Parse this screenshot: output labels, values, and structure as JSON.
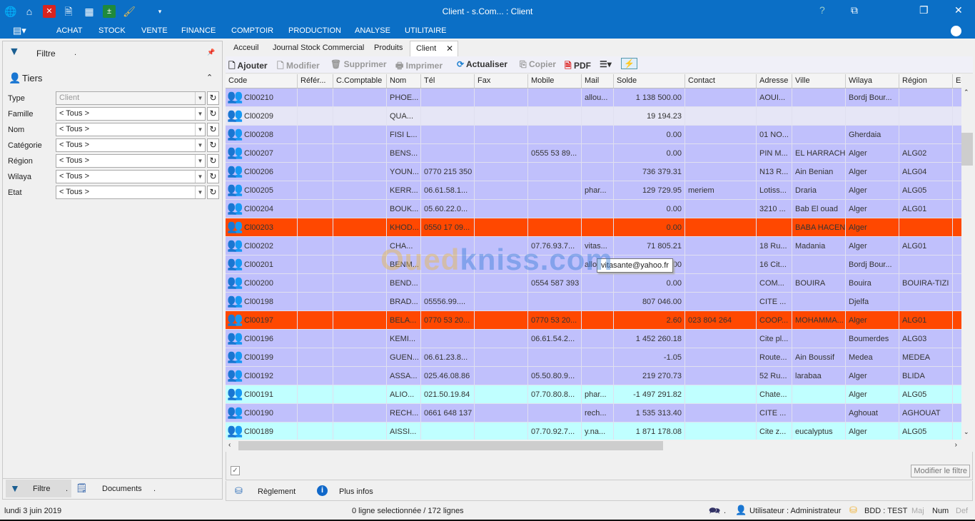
{
  "window": {
    "title": "Client - s.Com... : Client",
    "help": "?"
  },
  "quick_access": [
    "globe-icon",
    "home-icon",
    "close-red-icon",
    "search-doc-icon",
    "calculator-icon",
    "excel-icon",
    "brush-icon",
    "customize-icon"
  ],
  "menu": [
    "ACHAT",
    "STOCK",
    "VENTE",
    "FINANCE",
    "COMPTOIR",
    "PRODUCTION",
    "ANALYSE",
    "UTILITAIRE"
  ],
  "filter_panel": {
    "title": "Filtre",
    "dot": ".",
    "section": "Tiers",
    "fields": [
      {
        "label": "Type",
        "value": "Client"
      },
      {
        "label": "Famille",
        "value": "< Tous >"
      },
      {
        "label": "Nom",
        "value": "< Tous >"
      },
      {
        "label": "Catégorie",
        "value": "< Tous >"
      },
      {
        "label": "Région",
        "value": "< Tous >"
      },
      {
        "label": "Wilaya",
        "value": "< Tous >"
      },
      {
        "label": "Etat",
        "value": "< Tous >"
      }
    ],
    "bottom_tabs": [
      {
        "label": "Filtre",
        "dot": "."
      },
      {
        "label": "Documents",
        "dot": "."
      }
    ]
  },
  "tabs": [
    "Acceuil",
    "Journal Stock Commercial",
    "Produits",
    "Client"
  ],
  "toolbar": {
    "ajouter": "Ajouter",
    "modifier": "Modifier",
    "supprimer": "Supprimer",
    "imprimer": "Imprimer",
    "actualiser": "Actualiser",
    "copier": "Copier",
    "pdf": "PDF"
  },
  "colors": {
    "row_default": "#c0c0fc",
    "row_alt": "#e6e6f6",
    "row_orange": "#ff4800",
    "row_cyan": "#c0ffff",
    "title_bar": "#0b6fc6"
  },
  "table": {
    "columns": [
      "Code",
      "Référ...",
      "C.Comptable",
      "Nom",
      "Tél",
      "Fax",
      "Mobile",
      "Mail",
      "Solde",
      "Contact",
      "Adresse",
      "Ville",
      "Wilaya",
      "Région",
      "Echéa"
    ],
    "rows": [
      {
        "style": "default",
        "cells": [
          "Cl00210",
          "",
          "",
          "PHOE...",
          "",
          "",
          "",
          "allou...",
          "1 138 500.00",
          "",
          "AOUI...",
          "",
          "Bordj Bour...",
          "",
          ""
        ]
      },
      {
        "style": "alt",
        "cells": [
          "Cl00209",
          "",
          "",
          "QUA...",
          "",
          "",
          "",
          "",
          "19 194.23",
          "",
          "",
          "",
          "",
          "",
          ""
        ]
      },
      {
        "style": "default",
        "cells": [
          "Cl00208",
          "",
          "",
          "FISI L...",
          "",
          "",
          "",
          "",
          "0.00",
          "",
          "01 NO...",
          "",
          "Gherdaia",
          "",
          ""
        ]
      },
      {
        "style": "default",
        "cells": [
          "Cl00207",
          "",
          "",
          "BENS...",
          "",
          "",
          "0555 53 89...",
          "",
          "0.00",
          "",
          "PIN M...",
          "EL HARRACH",
          "Alger",
          "ALG02",
          ""
        ]
      },
      {
        "style": "default",
        "cells": [
          "Cl00206",
          "",
          "",
          "YOUN...",
          "0770 215 350",
          "",
          "",
          "",
          "736 379.31",
          "",
          "N13 R...",
          "Ain Benian",
          "Alger",
          "ALG04",
          ""
        ]
      },
      {
        "style": "default",
        "cells": [
          "Cl00205",
          "",
          "",
          "KERR...",
          "06.61.58.1...",
          "",
          "",
          "phar...",
          "129 729.95",
          "meriem",
          "Lotiss...",
          "Draria",
          "Alger",
          "ALG05",
          ""
        ]
      },
      {
        "style": "default",
        "cells": [
          "Cl00204",
          "",
          "",
          "BOUK...",
          "05.60.22.0...",
          "",
          "",
          "",
          "0.00",
          "",
          "3210 ...",
          "Bab El ouad",
          "Alger",
          "ALG01",
          ""
        ]
      },
      {
        "style": "orange",
        "cells": [
          "Cl00203",
          "",
          "",
          "KHOD...",
          "0550 17 09...",
          "",
          "",
          "",
          "0.00",
          "",
          "",
          "BABA HACEN",
          "Alger",
          "",
          ""
        ]
      },
      {
        "style": "default",
        "cells": [
          "Cl00202",
          "",
          "",
          "CHA...",
          "",
          "",
          "07.76.93.7...",
          "vitas...",
          "71 805.21",
          "",
          "18 Ru...",
          "Madania",
          "Alger",
          "ALG01",
          ""
        ]
      },
      {
        "style": "default",
        "cells": [
          "Cl00201",
          "",
          "",
          "BENM...",
          "",
          "",
          "",
          "allo...",
          "...00",
          "",
          "16 Cit...",
          "",
          "Bordj Bour...",
          "",
          ""
        ]
      },
      {
        "style": "default",
        "cells": [
          "Cl00200",
          "",
          "",
          "BEND...",
          "",
          "",
          "0554 587 393",
          "",
          "0.00",
          "",
          "COM...",
          "BOUIRA",
          "Bouira",
          "BOUIRA-TIZI",
          ""
        ]
      },
      {
        "style": "default",
        "cells": [
          "Cl00198",
          "",
          "",
          "BRAD...",
          "05556.99....",
          "",
          "",
          "",
          "807 046.00",
          "",
          "CITE ...",
          "",
          "Djelfa",
          "",
          ""
        ]
      },
      {
        "style": "orange",
        "cells": [
          "Cl00197",
          "",
          "",
          "BELA...",
          "0770 53 20...",
          "",
          "0770 53 20...",
          "",
          "2.60",
          "023 804 264",
          "COOP...",
          "MOHAMMA...",
          "Alger",
          "ALG01",
          ""
        ]
      },
      {
        "style": "default",
        "cells": [
          "Cl00196",
          "",
          "",
          "KEMI...",
          "",
          "",
          "06.61.54.2...",
          "",
          "1 452 260.18",
          "",
          "Cite pl...",
          "",
          "Boumerdes",
          "ALG03",
          ""
        ]
      },
      {
        "style": "default",
        "cells": [
          "Cl00199",
          "",
          "",
          "GUEN...",
          "06.61.23.8...",
          "",
          "",
          "",
          "-1.05",
          "",
          "Route...",
          "Ain Boussif",
          "Medea",
          "MEDEA",
          ""
        ]
      },
      {
        "style": "default",
        "cells": [
          "Cl00192",
          "",
          "",
          "ASSA...",
          "025.46.08.86",
          "",
          "05.50.80.9...",
          "",
          "219 270.73",
          "",
          "52 Ru...",
          "larabaa",
          "Alger",
          "BLIDA",
          ""
        ]
      },
      {
        "style": "cyan",
        "cells": [
          "Cl00191",
          "",
          "",
          "ALIO...",
          "021.50.19.84",
          "",
          "07.70.80.8...",
          "phar...",
          "-1 497 291.82",
          "",
          "Chate...",
          "",
          "Alger",
          "ALG05",
          ""
        ]
      },
      {
        "style": "default",
        "cells": [
          "Cl00190",
          "",
          "",
          "RECH...",
          "0661 648 137",
          "",
          "",
          "rech...",
          "1 535 313.40",
          "",
          "CITE ...",
          "",
          "Aghouat",
          "AGHOUAT",
          ""
        ]
      },
      {
        "style": "cyan",
        "cells": [
          "Cl00189",
          "",
          "",
          "AISSI...",
          "",
          "",
          "07.70.92.7...",
          "y.na...",
          "1 871 178.08",
          "",
          "Cite z...",
          "eucalyptus",
          "Alger",
          "ALG05",
          ""
        ]
      }
    ]
  },
  "tooltip": "vitasante@yahoo.fr",
  "watermark": {
    "part1": "Oued",
    "part2": "kniss",
    "part3": ".com"
  },
  "bottom": {
    "modify_filter": "Modifier le filtre",
    "reglement": "Règlement",
    "plus_infos": "Plus infos"
  },
  "status": {
    "date": "lundi 3 juin 2019",
    "selection": "0 ligne selectionnée / 172 lignes",
    "dot": ".",
    "user": "Utilisateur : Administrateur",
    "db": "BDD : TEST",
    "maj": "Maj",
    "num": "Num",
    "def": "Def"
  }
}
